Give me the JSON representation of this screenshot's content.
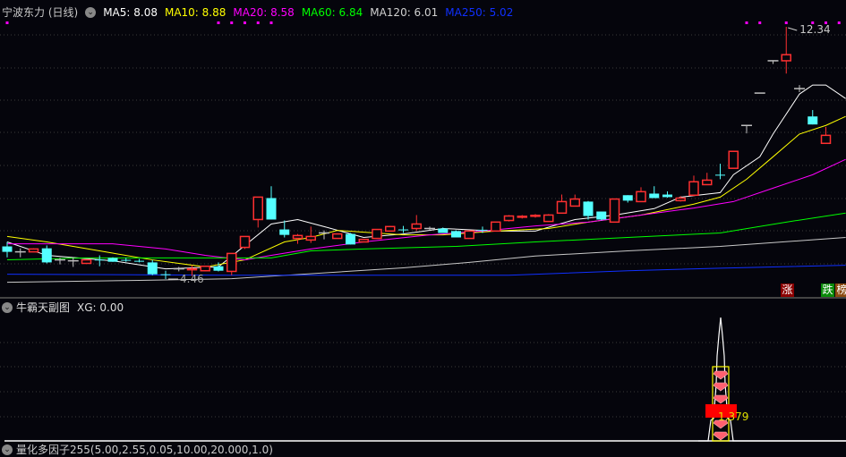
{
  "header": {
    "stock_title": "宁波东力 (日线)",
    "ma_labels": [
      {
        "text": "MA5: 8.08",
        "color": "#ffffff"
      },
      {
        "text": "MA10: 8.88",
        "color": "#ffff00"
      },
      {
        "text": "MA20: 8.58",
        "color": "#ff00ff"
      },
      {
        "text": "MA60: 6.84",
        "color": "#00ff00"
      },
      {
        "text": "MA120: 6.01",
        "color": "#d0d0d0"
      },
      {
        "text": "MA250: 5.02",
        "color": "#1030ff"
      }
    ]
  },
  "chart_data": {
    "type": "candlestick",
    "price_range": [
      4.3,
      12.6
    ],
    "high_label": "12.34",
    "low_label": "4.46",
    "colors": {
      "up": "#ff3030",
      "down": "#54ffff",
      "flat": "#c0c0c0"
    },
    "candles": [
      [
        5.48,
        5.31,
        5.62,
        5.14
      ],
      [
        5.31,
        5.31,
        5.42,
        5.14
      ],
      [
        5.31,
        5.4,
        5.42,
        5.31
      ],
      [
        5.42,
        4.98,
        5.51,
        4.95
      ],
      [
        5.06,
        5.06,
        5.12,
        4.92
      ],
      [
        5.03,
        5.03,
        5.14,
        4.84
      ],
      [
        4.95,
        5.06,
        5.06,
        4.95
      ],
      [
        5.07,
        5.06,
        5.2,
        4.86
      ],
      [
        5.12,
        5.0,
        5.14,
        5.0
      ],
      [
        5.06,
        5.05,
        5.12,
        5.0
      ],
      [
        5.03,
        5.02,
        5.09,
        4.98
      ],
      [
        4.98,
        4.61,
        5.06,
        4.58
      ],
      [
        4.61,
        4.6,
        4.72,
        4.46
      ],
      [
        4.78,
        4.78,
        4.84,
        4.7
      ],
      [
        4.75,
        4.78,
        4.89,
        4.56
      ],
      [
        4.72,
        4.86,
        4.86,
        4.7
      ],
      [
        4.86,
        4.72,
        4.98,
        4.7
      ],
      [
        4.7,
        5.26,
        5.26,
        4.58
      ],
      [
        5.45,
        5.79,
        5.79,
        5.4
      ],
      [
        6.32,
        7.02,
        7.02,
        6.07
      ],
      [
        6.99,
        6.32,
        7.36,
        6.32
      ],
      [
        6.01,
        5.84,
        6.29,
        5.76
      ],
      [
        5.73,
        5.82,
        5.87,
        5.56
      ],
      [
        5.68,
        5.79,
        6.1,
        5.59
      ],
      [
        5.9,
        5.9,
        5.98,
        5.7
      ],
      [
        5.73,
        5.87,
        5.87,
        5.73
      ],
      [
        5.87,
        5.54,
        5.9,
        5.54
      ],
      [
        5.62,
        5.7,
        5.7,
        5.62
      ],
      [
        5.73,
        6.01,
        6.01,
        5.73
      ],
      [
        5.96,
        6.1,
        6.12,
        5.96
      ],
      [
        6.01,
        6.0,
        6.12,
        5.9
      ],
      [
        6.04,
        6.18,
        6.46,
        5.96
      ],
      [
        6.04,
        6.04,
        6.1,
        5.98
      ],
      [
        6.04,
        5.9,
        6.07,
        5.9
      ],
      [
        5.96,
        5.76,
        5.98,
        5.76
      ],
      [
        5.73,
        5.96,
        5.96,
        5.73
      ],
      [
        6.0,
        5.98,
        6.1,
        5.9
      ],
      [
        5.96,
        6.24,
        6.24,
        5.96
      ],
      [
        6.29,
        6.43,
        6.46,
        6.26
      ],
      [
        6.4,
        6.42,
        6.46,
        6.35
      ],
      [
        6.43,
        6.45,
        6.49,
        6.38
      ],
      [
        6.26,
        6.46,
        6.49,
        6.26
      ],
      [
        6.52,
        6.88,
        7.1,
        6.52
      ],
      [
        6.74,
        6.96,
        7.1,
        6.74
      ],
      [
        6.88,
        6.43,
        6.9,
        6.32
      ],
      [
        6.57,
        6.32,
        6.57,
        6.29
      ],
      [
        6.24,
        6.96,
        6.96,
        6.24
      ],
      [
        7.08,
        6.91,
        7.08,
        6.85
      ],
      [
        6.88,
        7.19,
        7.33,
        6.88
      ],
      [
        7.13,
        6.99,
        7.36,
        6.99
      ],
      [
        7.1,
        7.02,
        7.2,
        7.0
      ],
      [
        6.91,
        6.99,
        7.05,
        6.88
      ],
      [
        7.08,
        7.5,
        7.69,
        7.05
      ],
      [
        7.41,
        7.55,
        7.78,
        7.41
      ],
      [
        7.72,
        7.7,
        8.06,
        7.58
      ],
      [
        7.92,
        8.45,
        8.45,
        7.92
      ],
      [
        9.26,
        9.26,
        9.26,
        9.01
      ],
      [
        10.27,
        10.27,
        10.27,
        10.27
      ],
      [
        11.28,
        11.28,
        11.28,
        11.18
      ],
      [
        11.28,
        11.47,
        12.34,
        10.88
      ],
      [
        10.41,
        10.41,
        10.52,
        10.3
      ],
      [
        9.54,
        9.29,
        9.74,
        9.29
      ],
      [
        8.7,
        8.95,
        9.21,
        8.7
      ]
    ],
    "ma_series": [
      {
        "name": "MA5",
        "color": "#ffffff",
        "points": [
          [
            0,
            5.62
          ],
          [
            3,
            5.2
          ],
          [
            8,
            5.03
          ],
          [
            12,
            4.78
          ],
          [
            16,
            4.84
          ],
          [
            20,
            6.18
          ],
          [
            22,
            6.32
          ],
          [
            24,
            6.1
          ],
          [
            27,
            5.76
          ],
          [
            30,
            5.87
          ],
          [
            33,
            6.04
          ],
          [
            37,
            5.96
          ],
          [
            40,
            5.96
          ],
          [
            43,
            6.32
          ],
          [
            46,
            6.46
          ],
          [
            49,
            6.66
          ],
          [
            51,
            7.02
          ],
          [
            54,
            7.16
          ],
          [
            55,
            7.72
          ],
          [
            57,
            8.28
          ],
          [
            58,
            8.99
          ],
          [
            60,
            10.24
          ],
          [
            61,
            10.52
          ],
          [
            62,
            10.52
          ],
          [
            63.5,
            10.1
          ]
        ]
      },
      {
        "name": "MA10",
        "color": "#ffff00",
        "points": [
          [
            0,
            5.79
          ],
          [
            3,
            5.62
          ],
          [
            7,
            5.34
          ],
          [
            11,
            5.06
          ],
          [
            15,
            4.84
          ],
          [
            18,
            5.06
          ],
          [
            21,
            5.62
          ],
          [
            23,
            5.76
          ],
          [
            25,
            5.98
          ],
          [
            30,
            5.84
          ],
          [
            33,
            5.84
          ],
          [
            37,
            5.96
          ],
          [
            41,
            6.04
          ],
          [
            44,
            6.24
          ],
          [
            48,
            6.46
          ],
          [
            52,
            6.8
          ],
          [
            54,
            7.02
          ],
          [
            56,
            7.58
          ],
          [
            58,
            8.28
          ],
          [
            60,
            8.99
          ],
          [
            62,
            9.26
          ],
          [
            63.5,
            9.54
          ]
        ]
      },
      {
        "name": "MA20",
        "color": "#ff00ff",
        "points": [
          [
            0,
            5.56
          ],
          [
            8,
            5.56
          ],
          [
            12,
            5.4
          ],
          [
            15,
            5.2
          ],
          [
            18,
            5.06
          ],
          [
            20,
            5.2
          ],
          [
            23,
            5.4
          ],
          [
            27,
            5.62
          ],
          [
            32,
            5.84
          ],
          [
            36,
            5.96
          ],
          [
            40,
            6.12
          ],
          [
            44,
            6.24
          ],
          [
            48,
            6.46
          ],
          [
            52,
            6.68
          ],
          [
            55,
            6.88
          ],
          [
            58,
            7.3
          ],
          [
            61,
            7.72
          ],
          [
            63.5,
            8.2
          ]
        ]
      },
      {
        "name": "MA60",
        "color": "#00ff00",
        "points": [
          [
            0,
            5.06
          ],
          [
            6,
            5.12
          ],
          [
            20,
            5.12
          ],
          [
            23,
            5.34
          ],
          [
            27,
            5.4
          ],
          [
            34,
            5.48
          ],
          [
            40,
            5.62
          ],
          [
            47,
            5.76
          ],
          [
            54,
            5.9
          ],
          [
            59,
            6.24
          ],
          [
            63.5,
            6.52
          ]
        ]
      },
      {
        "name": "MA120",
        "color": "#c8c8c8",
        "points": [
          [
            0,
            4.36
          ],
          [
            10,
            4.42
          ],
          [
            17,
            4.47
          ],
          [
            20,
            4.55
          ],
          [
            30,
            4.81
          ],
          [
            35,
            4.98
          ],
          [
            40,
            5.18
          ],
          [
            47,
            5.34
          ],
          [
            54,
            5.48
          ],
          [
            63.5,
            5.76
          ]
        ]
      },
      {
        "name": "MA250",
        "color": "#1030ff",
        "points": [
          [
            0,
            4.61
          ],
          [
            17,
            4.58
          ],
          [
            38,
            4.58
          ],
          [
            47,
            4.72
          ],
          [
            54,
            4.8
          ],
          [
            63.5,
            4.89
          ]
        ]
      }
    ],
    "signal_markers": [
      0,
      16,
      17,
      18,
      19,
      20,
      56,
      57,
      59,
      61,
      62,
      63
    ]
  },
  "signals": {
    "rise": "涨",
    "fall": "跌",
    "rank": "榜"
  },
  "sub_panel": {
    "title": "牛霸天副图",
    "xg": "XG: 0.00",
    "value_label": "1.379"
  },
  "bottom_panel": {
    "title": "量化多因子255(5.00,2.55,0.05,10.00,20.000,1.0)"
  }
}
